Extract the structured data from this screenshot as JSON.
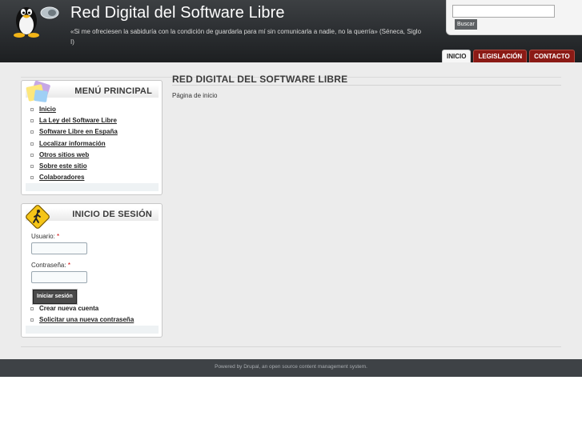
{
  "header": {
    "site_name": "Red Digital del Software Libre",
    "slogan": "«Si me ofreciesen la sabiduría con la condición de guardarla para mí sin comunicarla a nadie, no la querría» (Séneca, Siglo I)",
    "logo_icon": "tux-penguin-logo"
  },
  "search": {
    "value": "",
    "button_label": "Buscar"
  },
  "tabs": [
    {
      "label": "INICIO",
      "active": true
    },
    {
      "label": "LEGISLACIÓN",
      "active": false
    },
    {
      "label": "CONTACTO",
      "active": false
    }
  ],
  "main_menu": {
    "title": "MENÚ PRINCIPAL",
    "icon": "notes-icon",
    "items": [
      {
        "label": "Inicio"
      },
      {
        "label": "La Ley del Software Libre"
      },
      {
        "label": "Software Libre en España"
      },
      {
        "label": "Localizar información"
      },
      {
        "label": "Otros sitios web"
      },
      {
        "label": "Sobre este sitio"
      },
      {
        "label": "Colaboradores"
      }
    ]
  },
  "login": {
    "title": "INICIO DE SESIÓN",
    "icon": "pedestrian-sign-icon",
    "username_label": "Usuario:",
    "password_label": "Contraseña:",
    "required_mark": "*",
    "username_value": "",
    "password_value": "",
    "submit_label": "Iniciar sesión",
    "links": [
      {
        "label": "Crear nueva cuenta"
      },
      {
        "label": "Solicitar una nueva contraseña"
      }
    ]
  },
  "content": {
    "title": "RED DIGITAL DEL SOFTWARE LIBRE",
    "text": "Página de inicio"
  },
  "footer": {
    "text": "Powered by Drupal, an open source content management system."
  },
  "colors": {
    "header_dark": "#2a2d30",
    "tab_red": "#8b1a15",
    "band_gray": "#ececec",
    "footer_gray": "#3e4246"
  }
}
